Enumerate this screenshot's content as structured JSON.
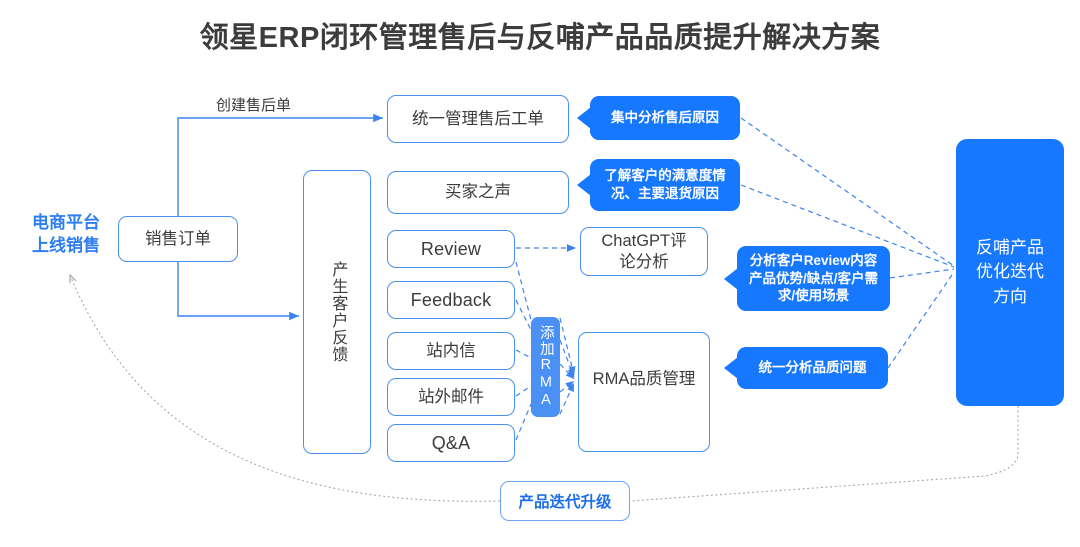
{
  "page": {
    "title": "领星ERP闭环管理售后与反哺产品品质提升解决方案",
    "accent_blue": "#1677FF",
    "outline_blue": "#4a90f0",
    "text_dark": "#3c3c3c",
    "loop_gray": "#9b9b9b"
  },
  "flow": {
    "start_label": "电商平台\n上线销售",
    "start_label_line1": "电商平台",
    "start_label_line2": "上线销售",
    "sales_order": "销售订单",
    "edge_create_ticket": "创建售后单",
    "customer_feedback": "产生客户反馈",
    "after_sales_ticket": "统一管理售后工单",
    "add_rma": "添加RMA",
    "rma_quality": "RMA品质管理",
    "chatgpt_analysis": "ChatGPT评\n论分析",
    "chatgpt_analysis_line1": "ChatGPT评",
    "chatgpt_analysis_line2": "论分析",
    "product_iteration": "产品迭代升级",
    "feedback_panel_line1": "反哺产品",
    "feedback_panel_line2": "优化迭代",
    "feedback_panel_line3": "方向"
  },
  "channels": [
    {
      "id": "voice-of-buyer",
      "label": "买家之声",
      "script": "cn"
    },
    {
      "id": "review",
      "label": "Review",
      "script": "latin"
    },
    {
      "id": "feedback",
      "label": "Feedback",
      "script": "latin"
    },
    {
      "id": "site-message",
      "label": "站内信",
      "script": "cn"
    },
    {
      "id": "external-mail",
      "label": "站外邮件",
      "script": "cn"
    },
    {
      "id": "qa",
      "label": "Q&A",
      "script": "latin"
    }
  ],
  "callouts": [
    {
      "id": "after-sales-reason",
      "lines": [
        "集中分析售后原因"
      ]
    },
    {
      "id": "satisfaction-return",
      "lines": [
        "了解客户的满意度情",
        "况、主要退货原因"
      ]
    },
    {
      "id": "review-content",
      "lines": [
        "分析客户Review内容",
        "产品优势/缺点/客户需",
        "求/使用场景"
      ]
    },
    {
      "id": "quality-issue",
      "lines": [
        "统一分析品质问题"
      ]
    }
  ]
}
